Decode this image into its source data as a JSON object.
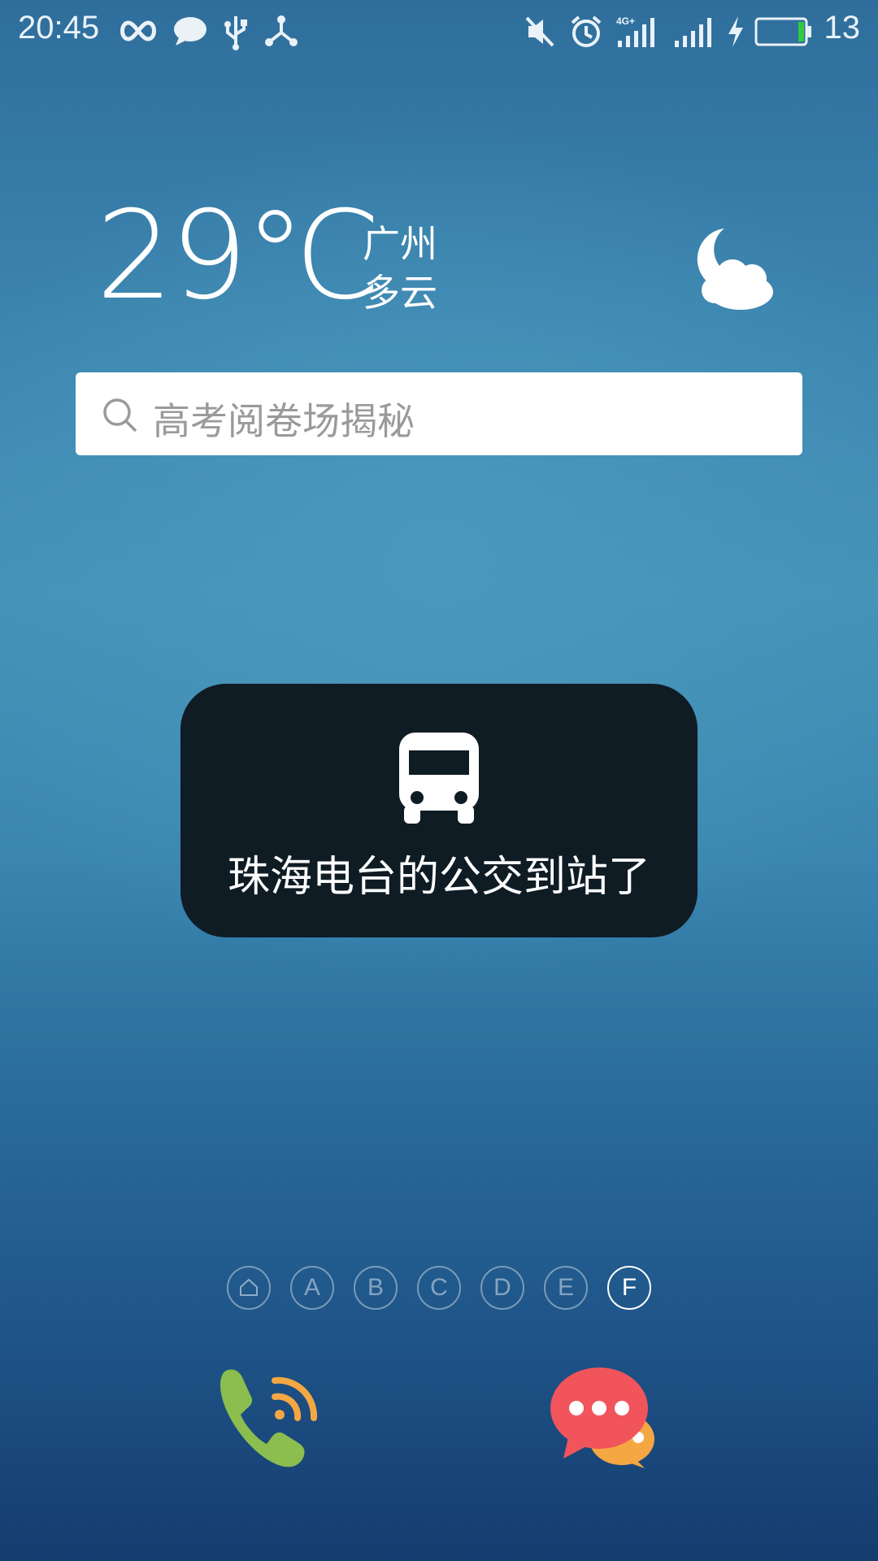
{
  "status_bar": {
    "time": "20:45",
    "network_label": "4G+",
    "battery_level": "13",
    "left_icons": [
      "infinity-icon",
      "chat-bubble-icon",
      "usb-icon",
      "share-nodes-icon"
    ],
    "right_icons": [
      "mute-icon",
      "alarm-icon",
      "signal-4g-icon",
      "signal-icon",
      "charging-bolt-icon",
      "battery-icon"
    ],
    "battery_fill_color": "#2ecc40"
  },
  "weather": {
    "temperature": "29",
    "unit": "℃",
    "city": "广州",
    "condition": "多云",
    "icon": "moon-cloud-icon"
  },
  "search": {
    "placeholder": "高考阅卷场揭秘"
  },
  "toast": {
    "icon": "bus-icon",
    "message": "珠海电台的公交到站了",
    "background": "#0f1c24"
  },
  "page_indicator": {
    "pages": [
      "⌂",
      "A",
      "B",
      "C",
      "D",
      "E",
      "F"
    ],
    "active_page": "F"
  },
  "dock": {
    "apps": [
      {
        "name": "phone",
        "icon": "phone-icon"
      },
      {
        "name": "messages",
        "icon": "messages-icon"
      }
    ]
  }
}
